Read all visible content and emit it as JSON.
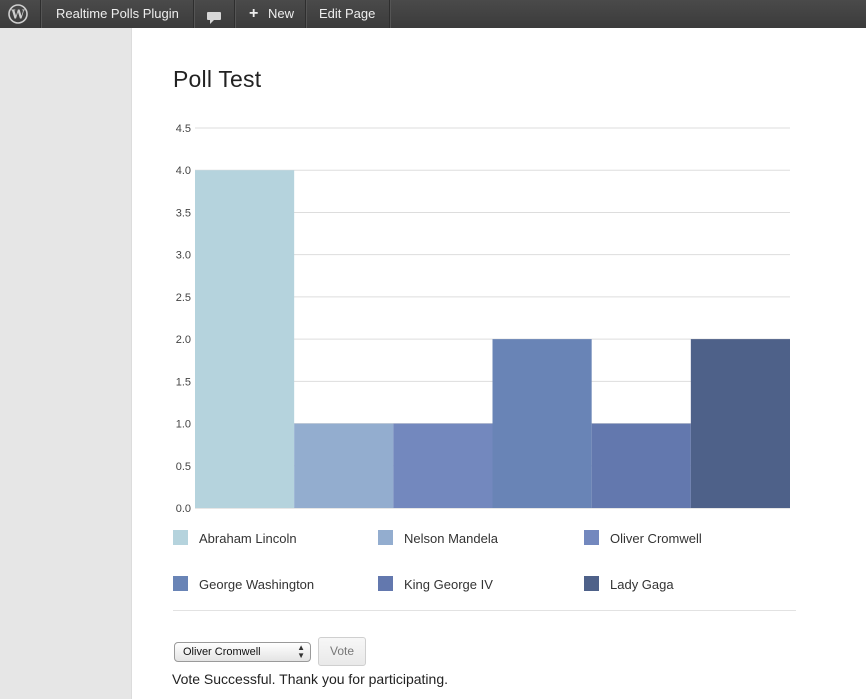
{
  "admin_bar": {
    "site_name": "Realtime Polls Plugin",
    "new_plus": "+",
    "new_label": "New",
    "edit_label": "Edit Page",
    "logo_icon": "wordpress-logo-icon",
    "comments_icon": "comment-bubble-icon"
  },
  "page": {
    "title": "Poll Test"
  },
  "chart_data": {
    "type": "bar",
    "categories": [
      "Abraham Lincoln",
      "Nelson Mandela",
      "Oliver Cromwell",
      "George Washington",
      "King George IV",
      "Lady Gaga"
    ],
    "values": [
      4,
      1,
      1,
      2,
      1,
      2
    ],
    "colors": [
      "#b5d3dd",
      "#93adcf",
      "#7388be",
      "#6984b6",
      "#6378ae",
      "#4e6189"
    ],
    "ylim": [
      0,
      4.5
    ],
    "yticks": [
      "0.0",
      "0.5",
      "1.0",
      "1.5",
      "2.0",
      "2.5",
      "3.0",
      "3.5",
      "4.0",
      "4.5"
    ],
    "grid": true,
    "legend_placement": "bottom",
    "title": "",
    "xlabel": "",
    "ylabel": ""
  },
  "legend": [
    {
      "label": "Abraham Lincoln",
      "color": "#b5d3dd"
    },
    {
      "label": "Nelson Mandela",
      "color": "#93adcf"
    },
    {
      "label": "Oliver Cromwell",
      "color": "#7388be"
    },
    {
      "label": "George Washington",
      "color": "#6984b6"
    },
    {
      "label": "King George IV",
      "color": "#6378ae"
    },
    {
      "label": "Lady Gaga",
      "color": "#4e6189"
    }
  ],
  "form": {
    "selected_option": "Oliver Cromwell",
    "vote_label": "Vote"
  },
  "status": {
    "message": "Vote Successful. Thank you for participating."
  }
}
